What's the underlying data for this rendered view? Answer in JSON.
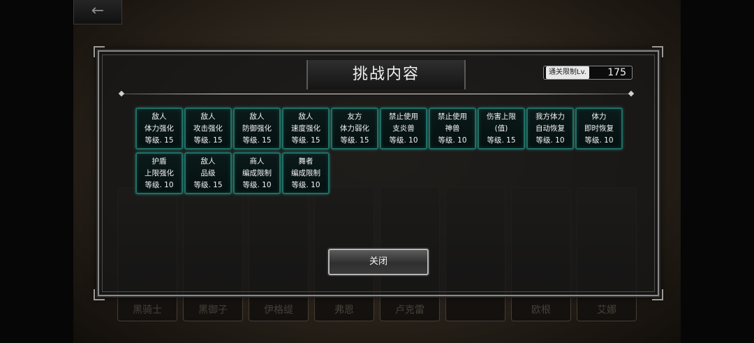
{
  "back_button": {
    "icon": "arrow-left-icon",
    "glyph": "←"
  },
  "dialog": {
    "title": "挑战内容",
    "limit_label": "通关限制Lv.",
    "limit_value": "175",
    "close_label": "关闭"
  },
  "effects": [
    {
      "line1": "敌人",
      "line2": "体力强化",
      "level": "等级. 15"
    },
    {
      "line1": "敌人",
      "line2": "攻击强化",
      "level": "等级. 15"
    },
    {
      "line1": "敌人",
      "line2": "防御强化",
      "level": "等级. 15"
    },
    {
      "line1": "敌人",
      "line2": "速度强化",
      "level": "等级. 15"
    },
    {
      "line1": "友方",
      "line2": "体力弱化",
      "level": "等级. 15"
    },
    {
      "line1": "禁止使用",
      "line2": "支炎兽",
      "level": "等级. 10"
    },
    {
      "line1": "禁止使用",
      "line2": "神兽",
      "level": "等级. 10"
    },
    {
      "line1": "伤害上限",
      "line2": "(值)",
      "level": "等级. 15"
    },
    {
      "line1": "我方体力",
      "line2": "自动恢复",
      "level": "等级. 10"
    },
    {
      "line1": "体力",
      "line2": "即时恢复",
      "level": "等级. 10"
    },
    {
      "line1": "护盾",
      "line2": "上限强化",
      "level": "等级. 10"
    },
    {
      "line1": "敌人",
      "line2": "品级",
      "level": "等级. 15"
    },
    {
      "line1": "商人",
      "line2": "编成限制",
      "level": "等级. 10"
    },
    {
      "line1": "舞者",
      "line2": "编成限制",
      "level": "等级. 10"
    }
  ],
  "characters": [
    "黑骑士",
    "黑御子",
    "伊格缇",
    "弗恩",
    "卢克雷",
    "",
    "欧根",
    "艾娜"
  ]
}
